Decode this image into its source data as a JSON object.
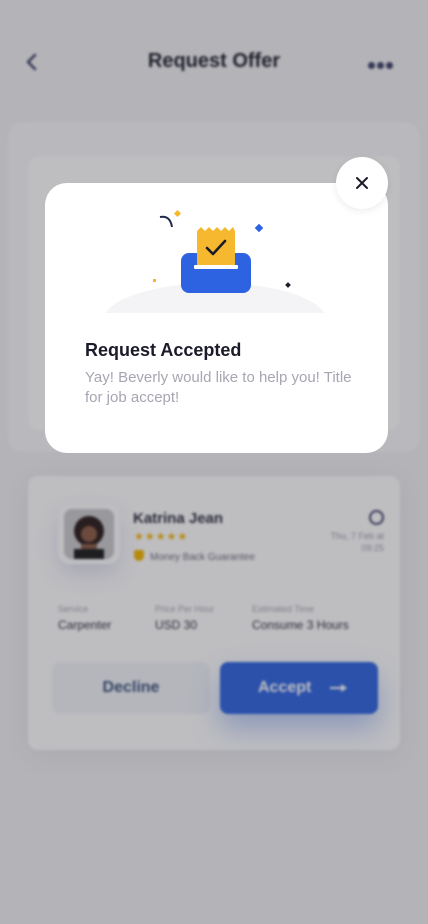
{
  "header": {
    "title": "Request Offer",
    "back_icon": "chevron-left-icon",
    "more_icon": "more-horizontal-icon"
  },
  "offer": {
    "provider_name": "Katrina Jean",
    "rating_stars": "★★★★★",
    "guarantee_label": "Money Back Guarantee",
    "date": "Thu, 7 Feb at 09:25",
    "fields": [
      {
        "label": "Service",
        "value": "Carpenter"
      },
      {
        "label": "Price Per Hour",
        "value": "USD 30"
      },
      {
        "label": "Estimated Time",
        "value": "Consume 3 Hours"
      }
    ],
    "decline_label": "Decline",
    "accept_label": "Accept"
  },
  "modal": {
    "title": "Request Accepted",
    "message": "Yay! Beverly would like to help you! Title for job accept!",
    "close_icon": "close-icon"
  },
  "colors": {
    "accent": "#2d63e0",
    "star": "#f4b400",
    "illustration_yellow": "#f5b82e"
  }
}
